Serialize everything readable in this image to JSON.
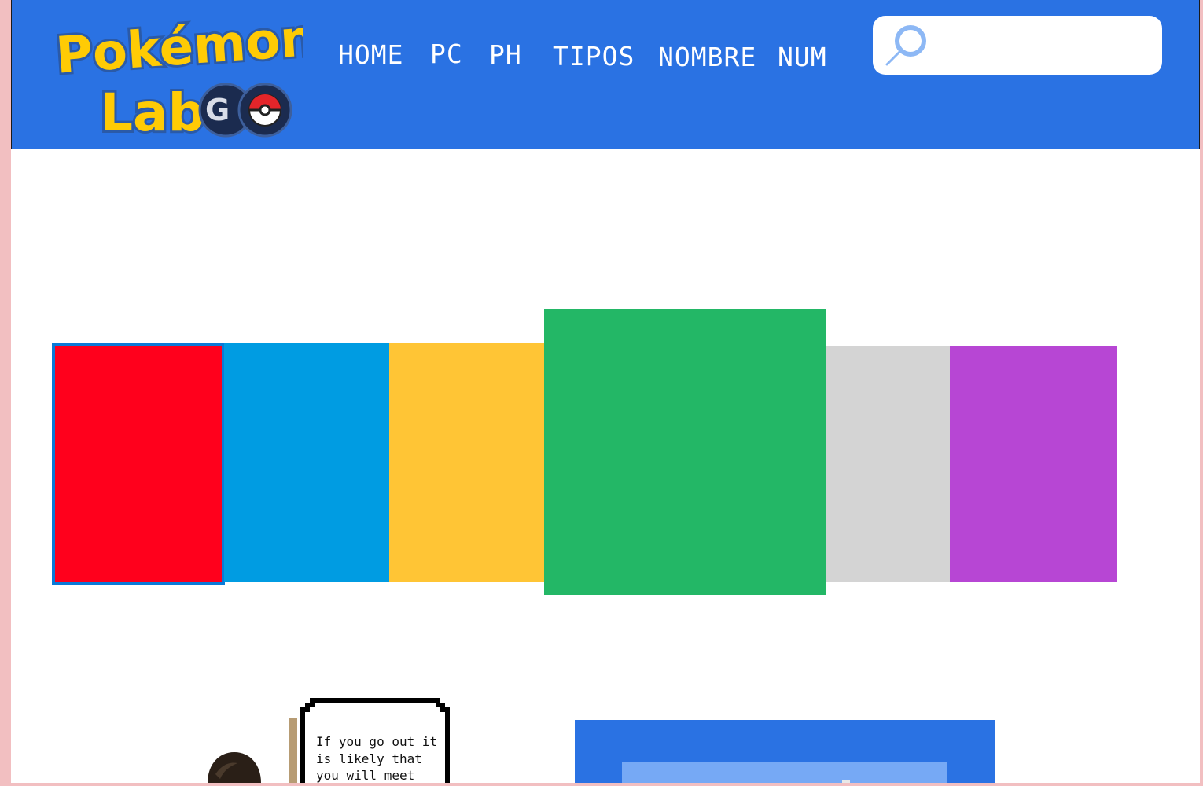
{
  "header": {
    "logo": {
      "text": "Pokémon Lab GO",
      "icon": "pokeball-icon"
    },
    "nav": [
      {
        "label": "HOME"
      },
      {
        "label": "PC"
      },
      {
        "label": "PH"
      },
      {
        "label": "TIPOS"
      },
      {
        "label": "NOMBRE"
      },
      {
        "label": "NUM"
      }
    ],
    "search": {
      "placeholder": "",
      "value": "",
      "icon": "search-icon"
    }
  },
  "type_blocks": [
    {
      "name": "red",
      "color": "#ff001c"
    },
    {
      "name": "blue",
      "color": "#009ce2"
    },
    {
      "name": "yellow",
      "color": "#ffc535"
    },
    {
      "name": "green",
      "color": "#23b766"
    },
    {
      "name": "gray",
      "color": "#d4d4d4"
    },
    {
      "name": "purple",
      "color": "#b746d4"
    }
  ],
  "dialog": {
    "text": "If you go out it is likely that you will meet"
  },
  "colors": {
    "header_bg": "#2a72e3",
    "side_bg": "#f2bfc1",
    "selected_border": "#0a7ad8"
  }
}
